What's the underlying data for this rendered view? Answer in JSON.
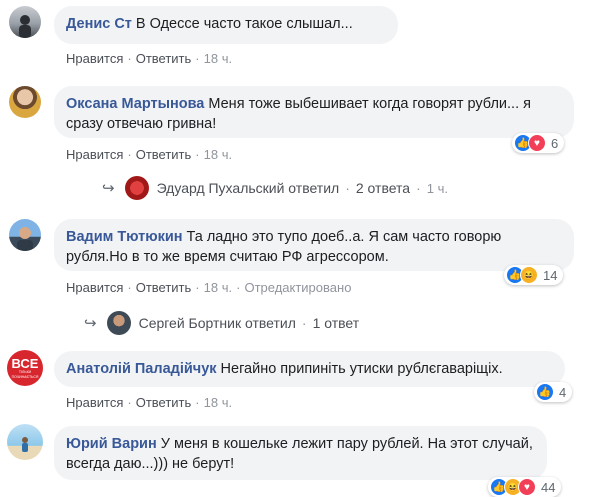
{
  "actions": {
    "like": "Нравится",
    "reply": "Ответить",
    "edited": "Отредактировано",
    "dot": "·"
  },
  "comments": [
    {
      "author": "Денис Ст",
      "text": "В Одессе часто такое слышал...",
      "time": "18 ч."
    },
    {
      "author": "Оксана Мартынова",
      "text": "Меня тоже выбешивает когда говорят рубли... я сразу отвечаю гривна!",
      "time": "18 ч.",
      "reactions": "6"
    },
    {
      "author": "Вадим Тютюкин",
      "text": "Та ладно это тупо доеб..а. Я сам часто говорю рубля.Но в то же время считаю РФ агрессором.",
      "time": "18 ч.",
      "reactions": "14"
    },
    {
      "author": "Анатолій Паладійчук",
      "text": "Негайно припиніть утиски рублєгаваріщіх.",
      "time": "18 ч.",
      "reactions": "4",
      "avatar_text": "ВСЕ",
      "avatar_subtext": "ТІЛЬКИ ПОЧИНАЄТЬСЯ"
    },
    {
      "author": "Юрий Варин",
      "text": "У меня в кошельке лежит пару рублей. На этот случай, всегда даю...))) не берут!",
      "reactions": "44"
    }
  ],
  "replies": [
    {
      "text": "Эдуард Пухальский ответил",
      "count": "2 ответа",
      "time": "1 ч."
    },
    {
      "text": "Сергей Бортник ответил",
      "count": "1 ответ"
    }
  ],
  "colors": {
    "link": "#385898",
    "bubble": "#f2f3f5",
    "like": "#1877f2",
    "love": "#f33e58",
    "haha": "#f7b125"
  }
}
